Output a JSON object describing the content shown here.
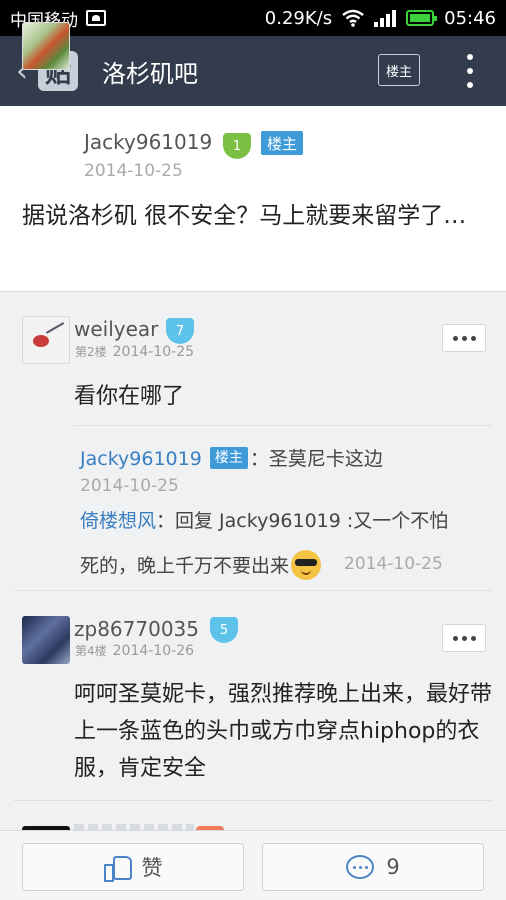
{
  "status_bar": {
    "carrier": "中国移动",
    "speed": "0.29K/s",
    "time": "05:46"
  },
  "header": {
    "logo_text": "贴",
    "title": "洛杉矶吧",
    "op_only_label": "楼主"
  },
  "main_post": {
    "author": "Jacky961019",
    "level": "1",
    "op_tag": "楼主",
    "date": "2014-10-25",
    "body": "据说洛杉矶 很不安全？马上就要来留学了…"
  },
  "replies": [
    {
      "author": "weilyear",
      "level": "7",
      "floor": "第2楼",
      "date": "2014-10-25",
      "body": "看你在哪了",
      "sub_replies": [
        {
          "author": "Jacky961019",
          "tag": "楼主",
          "text": "：圣莫尼卡这边",
          "date": "2014-10-25"
        },
        {
          "author": "倚楼想风",
          "text_line1": "：回复 Jacky961019 :又一个不怕",
          "text_line2": "死的，晚上千万不要出来",
          "emoji": "sunglasses-emoji",
          "date": "2014-10-25"
        }
      ]
    },
    {
      "author": "zp86770035",
      "level": "5",
      "floor": "第4楼",
      "date": "2014-10-26",
      "body": "呵呵圣莫妮卡，强烈推荐晚上出来，最好带上一条蓝色的头巾或方巾穿点hiphop的衣服，肯定安全"
    }
  ],
  "bottom_bar": {
    "like_label": "赞",
    "comment_count": "9"
  },
  "colors": {
    "header_bg": "#333c4c",
    "op_tag": "#3f9ad8",
    "link_blue": "#3a7fc1",
    "level_green": "#7bc043",
    "level_blue": "#5ec3ea"
  }
}
